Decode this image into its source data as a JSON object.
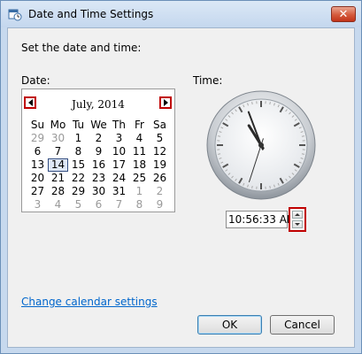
{
  "window": {
    "title": "Date and Time Settings",
    "close_glyph": "✕"
  },
  "heading": "Set the date and time:",
  "date_label": "Date:",
  "time_label": "Time:",
  "calendar": {
    "month_year": "July, 2014",
    "weekdays": [
      "Su",
      "Mo",
      "Tu",
      "We",
      "Th",
      "Fr",
      "Sa"
    ],
    "weeks": [
      [
        {
          "d": "29",
          "m": true
        },
        {
          "d": "30",
          "m": true
        },
        {
          "d": "1"
        },
        {
          "d": "2"
        },
        {
          "d": "3"
        },
        {
          "d": "4"
        },
        {
          "d": "5"
        }
      ],
      [
        {
          "d": "6"
        },
        {
          "d": "7"
        },
        {
          "d": "8"
        },
        {
          "d": "9"
        },
        {
          "d": "10"
        },
        {
          "d": "11"
        },
        {
          "d": "12"
        }
      ],
      [
        {
          "d": "13"
        },
        {
          "d": "14",
          "today": true
        },
        {
          "d": "15"
        },
        {
          "d": "16"
        },
        {
          "d": "17"
        },
        {
          "d": "18"
        },
        {
          "d": "19"
        }
      ],
      [
        {
          "d": "20"
        },
        {
          "d": "21"
        },
        {
          "d": "22"
        },
        {
          "d": "23"
        },
        {
          "d": "24"
        },
        {
          "d": "25"
        },
        {
          "d": "26"
        }
      ],
      [
        {
          "d": "27"
        },
        {
          "d": "28"
        },
        {
          "d": "29"
        },
        {
          "d": "30"
        },
        {
          "d": "31"
        },
        {
          "d": "1",
          "m": true
        },
        {
          "d": "2",
          "m": true
        }
      ],
      [
        {
          "d": "3",
          "m": true
        },
        {
          "d": "4",
          "m": true
        },
        {
          "d": "5",
          "m": true
        },
        {
          "d": "6",
          "m": true
        },
        {
          "d": "7",
          "m": true
        },
        {
          "d": "8",
          "m": true
        },
        {
          "d": "9",
          "m": true
        }
      ]
    ]
  },
  "clock": {
    "hour": 10,
    "minute": 56,
    "second": 33
  },
  "time_value": "10:56:33 AM",
  "link": "Change calendar settings",
  "buttons": {
    "ok": "OK",
    "cancel": "Cancel"
  },
  "colors": {
    "highlight": "#c00000",
    "link": "#0066cc",
    "titlebar": "#c4d7ee"
  }
}
